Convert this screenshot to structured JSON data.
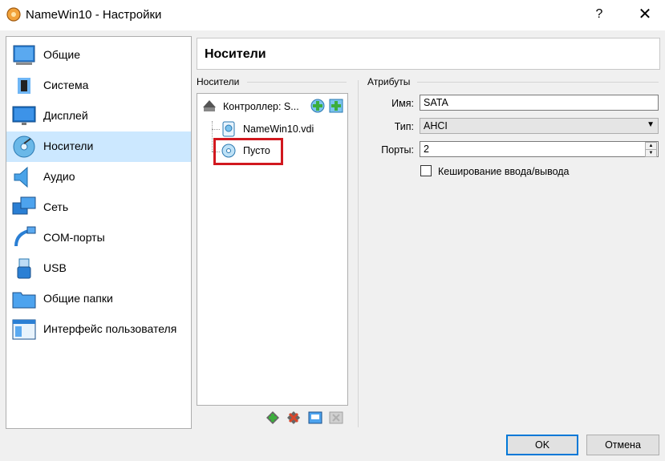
{
  "window": {
    "title": "NameWin10 - Настройки",
    "help": "?",
    "close": "✕"
  },
  "sidebar": {
    "items": [
      {
        "label": "Общие",
        "icon": "general-icon"
      },
      {
        "label": "Система",
        "icon": "system-icon"
      },
      {
        "label": "Дисплей",
        "icon": "display-icon"
      },
      {
        "label": "Носители",
        "icon": "storage-icon",
        "selected": true
      },
      {
        "label": "Аудио",
        "icon": "audio-icon"
      },
      {
        "label": "Сеть",
        "icon": "network-icon"
      },
      {
        "label": "COM-порты",
        "icon": "com-ports-icon"
      },
      {
        "label": "USB",
        "icon": "usb-icon"
      },
      {
        "label": "Общие папки",
        "icon": "shared-folders-icon"
      },
      {
        "label": "Интерфейс пользователя",
        "icon": "user-interface-icon"
      }
    ]
  },
  "header": {
    "title": "Носители"
  },
  "storage": {
    "group_label": "Носители",
    "controller": "Контроллер: S...",
    "devices": [
      {
        "label": "NameWin10.vdi",
        "icon": "hard-disk-icon"
      },
      {
        "label": "Пусто",
        "icon": "optical-disc-icon"
      }
    ]
  },
  "attributes": {
    "group_label": "Атрибуты",
    "name_label": "Имя:",
    "name_value": "SATA",
    "type_label": "Тип:",
    "type_value": "AHCI",
    "ports_label": "Порты:",
    "ports_value": "2",
    "cache_label": "Кеширование ввода/вывода",
    "cache_checked": false
  },
  "buttons": {
    "ok": "OK",
    "cancel": "Отмена"
  },
  "colors": {
    "selection": "#cce8ff",
    "highlight": "#d1181f",
    "accent": "#0078d7"
  }
}
